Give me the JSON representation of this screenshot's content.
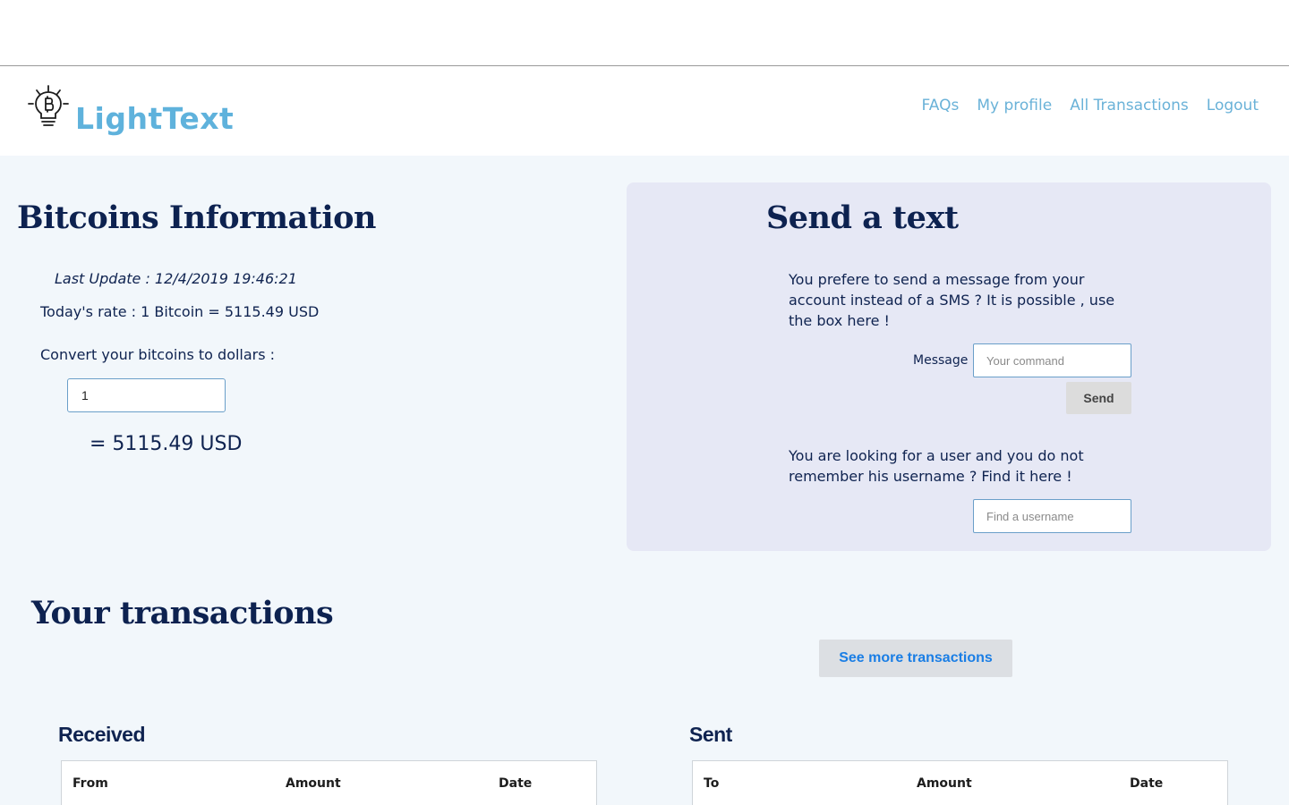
{
  "nav": {
    "brand": "LightText",
    "links": [
      "FAQs",
      "My profile",
      "All Transactions",
      "Logout"
    ]
  },
  "bitcoin": {
    "title": "Bitcoins Information",
    "last_update": "Last Update : 12/4/2019 19:46:21",
    "rate": "Today's rate : 1 Bitcoin = 5115.49 USD",
    "convert_label": "Convert your bitcoins to dollars :",
    "input_value": "1",
    "result": "= 5115.49 USD"
  },
  "send": {
    "title": "Send a text",
    "description": "You prefere to send a message from your account instead of a SMS ? It is possible , use the box here !",
    "message_label": "Message",
    "message_placeholder": "Your command",
    "send_label": "Send",
    "find_description": "You are looking for a user and you do not remember his username ? Find it here !",
    "find_placeholder": "Find a username"
  },
  "transactions": {
    "title": "Your transactions",
    "more_label": "See more transactions",
    "received": {
      "title": "Received",
      "columns": [
        "From",
        "Amount",
        "Date"
      ]
    },
    "sent": {
      "title": "Sent",
      "columns": [
        "To",
        "Amount",
        "Date"
      ]
    }
  },
  "colors": {
    "brand": "#5fb2dc",
    "heading": "#0d2250",
    "link": "#6ab2d8",
    "panel": "#e6e8f5",
    "accent_button_text": "#1a7ee5"
  },
  "icons": {
    "logo": "bitcoin-lightbulb-icon"
  }
}
